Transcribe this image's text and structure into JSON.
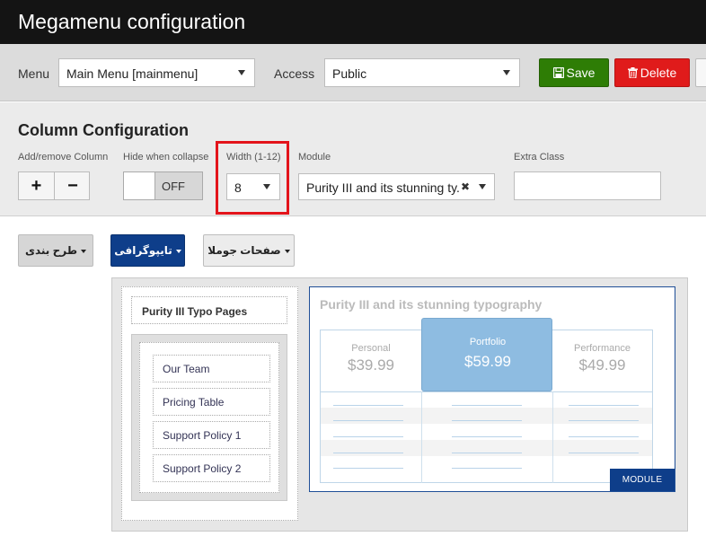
{
  "app": {
    "title": "Megamenu configuration"
  },
  "toolbar": {
    "menu_label": "Menu",
    "menu_value": "Main Menu [mainmenu]",
    "access_label": "Access",
    "access_value": "Public",
    "save_label": "Save",
    "delete_label": "Delete"
  },
  "column_config": {
    "heading": "Column Configuration",
    "add_remove_label": "Add/remove Column",
    "plus_symbol": "+",
    "minus_symbol": "−",
    "hide_collapse_label": "Hide when collapse",
    "hide_collapse_state": "OFF",
    "width_label": "Width (1-12)",
    "width_value": "8",
    "module_label": "Module",
    "module_value": "Purity III and its stunning ty.",
    "module_clear_symbol": "✖",
    "extra_class_label": "Extra Class",
    "extra_class_value": ""
  },
  "menubar": {
    "items": [
      {
        "label": "طرح بندی"
      },
      {
        "label": "تایپوگرافی"
      },
      {
        "label": "صفحات جوملا"
      }
    ]
  },
  "left_column": {
    "header": "Purity III Typo Pages",
    "items": [
      "Our Team",
      "Pricing Table",
      "Support Policy 1",
      "Support Policy 2"
    ]
  },
  "module_preview": {
    "title": "Purity III and its stunning typography",
    "plans": [
      {
        "name": "Personal",
        "price": "$39.99"
      },
      {
        "name": "Portfolio",
        "price": "$59.99"
      },
      {
        "name": "Performance",
        "price": "$49.99"
      }
    ],
    "badge": "MODULE"
  },
  "colors": {
    "accent_blue": "#0e3e8a",
    "save_green": "#2e7d05",
    "delete_red": "#e01b1b",
    "highlight_red": "#e3141b"
  }
}
